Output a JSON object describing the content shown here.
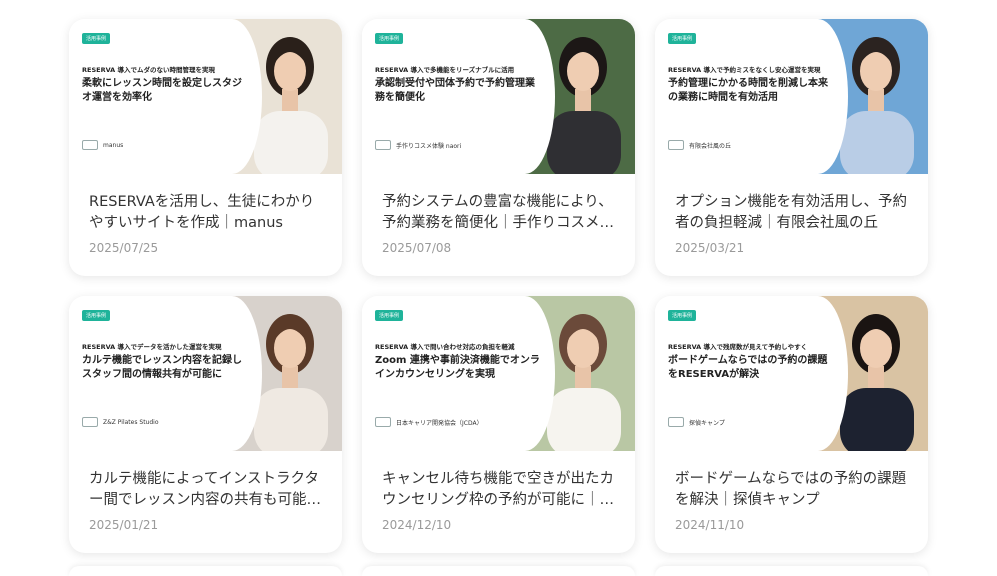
{
  "cards": [
    {
      "tag": "活用事例",
      "sub": "RESERVA 導入でムダのない時間管理を実現",
      "head": "柔軟にレッスン時間を設定しスタジオ運営を効率化",
      "brand": "manus",
      "title": "RESERVAを活用し、生徒にわかりやすいサイトを作成｜manus",
      "date": "2025/07/25",
      "photo_bg": "#e9e2d6",
      "shirt": "#f4f2ee",
      "hair": "#2a201a"
    },
    {
      "tag": "活用事例",
      "sub": "RESERVA 導入で多機能をリーズナブルに活用",
      "head": "承認制受付や団体予約で予約管理業務を簡便化",
      "brand": "手作りコスメ体験 naori",
      "title": "予約システムの豊富な機能により、予約業務を簡便化｜手作りコスメ体験 naori",
      "date": "2025/07/08",
      "photo_bg": "#4d6b45",
      "shirt": "#2f2f33",
      "hair": "#1c1716"
    },
    {
      "tag": "活用事例",
      "sub": "RESERVA 導入で予約ミスをなくし安心運営を実現",
      "head": "予約管理にかかる時間を削減し本来の業務に時間を有効活用",
      "brand": "有限会社風の丘",
      "title": "オプション機能を有効活用し、予約者の負担軽減｜有限会社風の丘",
      "date": "2025/03/21",
      "photo_bg": "#6fa6d6",
      "shirt": "#b9cde6",
      "hair": "#2b2320"
    },
    {
      "tag": "活用事例",
      "sub": "RESERVA 導入でデータを活かした運営を実現",
      "head": "カルテ機能でレッスン内容を記録しスタッフ間の情報共有が可能に",
      "brand": "Z&Z Pilates Studio",
      "title": "カルテ機能によってインストラクター間でレッスン内容の共有も可能に｜Z&Z Pilates Studio",
      "date": "2025/01/21",
      "photo_bg": "#d8d2cc",
      "shirt": "#efe9e2",
      "hair": "#5a3a28"
    },
    {
      "tag": "活用事例",
      "sub": "RESERVA 導入で問い合わせ対応の負担を軽減",
      "head": "Zoom 連携や事前決済機能でオンラインカウンセリングを実現",
      "brand": "日本キャリア開発協会（JCDA）",
      "title": "キャンセル待ち機能で空きが出たカウンセリング枠の予約が可能に｜日本キャリア開発協会",
      "date": "2024/12/10",
      "photo_bg": "#b9c7a4",
      "shirt": "#f6f4ef",
      "hair": "#6b4a3a"
    },
    {
      "tag": "活用事例",
      "sub": "RESERVA 導入で残席数が見えて予約しやすく",
      "head": "ボードゲームならではの予約の課題をRESERVAが解決",
      "brand": "探偵キャンプ",
      "title": "ボードゲームならではの予約の課題を解決｜探偵キャンプ",
      "date": "2024/11/10",
      "photo_bg": "#d9c3a3",
      "shirt": "#1d2230",
      "hair": "#1a1412"
    }
  ]
}
